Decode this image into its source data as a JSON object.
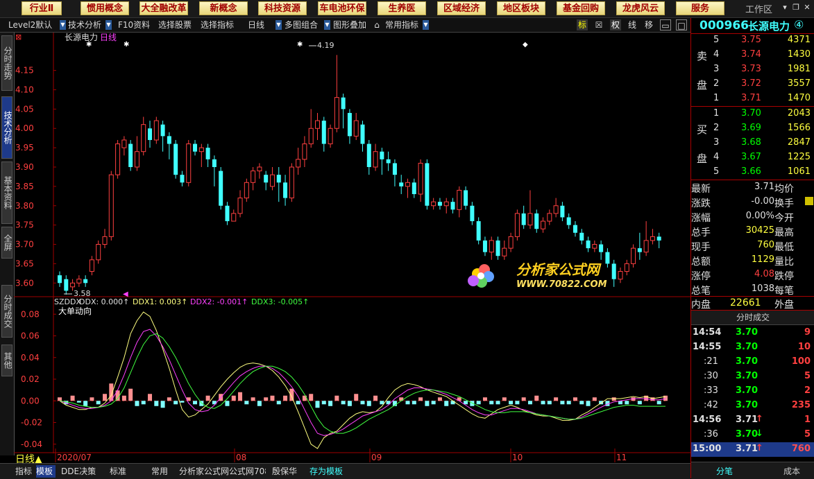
{
  "menu": {
    "items": [
      "行业Ⅱ",
      "惯用概念",
      "大全融改革",
      "新概念",
      "科技资源",
      "车电池环保",
      "生养医",
      "区域经济",
      "地区板块",
      "基金回购",
      "龙虎风云",
      "服务"
    ],
    "work_zone": "工作区"
  },
  "toolbar": {
    "items": [
      "Level2默认",
      "技术分析",
      "F10资料",
      "选择股票",
      "选择指标",
      "日线",
      "多图组合",
      "图形叠加",
      "常用指标"
    ],
    "right_items": [
      "标",
      "☒",
      "权",
      "线",
      "移"
    ]
  },
  "left_tabs": [
    "分时走势",
    "技术分析",
    "基本资料",
    "全屏",
    "分时成交",
    "其他"
  ],
  "chart": {
    "stock_title": "长源电力",
    "period_label": "日线",
    "high_label": "4.19",
    "low_label": "3.58",
    "price_ticks": [
      "4.15",
      "4.10",
      "4.05",
      "4.00",
      "3.95",
      "3.90",
      "3.85",
      "3.80",
      "3.75",
      "3.70",
      "3.65",
      "3.60"
    ],
    "indicator_header": {
      "name": "SZDDX",
      "ddx": "DDX: 0.000↑",
      "ddx1": "DDX1: 0.003↑",
      "ddx2": "DDX2: -0.001↑",
      "ddx3": "DDX3: -0.005↑"
    },
    "indicator_title": "大单动向",
    "indicator_ticks": [
      "0.08",
      "0.06",
      "0.04",
      "0.02",
      "0.00",
      "-0.02",
      "-0.04"
    ],
    "date_labels": [
      "2020/07",
      "08",
      "09",
      "10",
      "11"
    ],
    "period_bottom": "日线",
    "watermark_text": "分析家公式网",
    "watermark_url": "WWW.70822.COM"
  },
  "chart_data": {
    "type": "candlestick",
    "ylim": [
      3.57,
      4.23
    ],
    "candles": [
      [
        3.62,
        3.6,
        3.63,
        3.59
      ],
      [
        3.61,
        3.58,
        3.62,
        3.57
      ],
      [
        3.59,
        3.6,
        3.61,
        3.58
      ],
      [
        3.6,
        3.61,
        3.62,
        3.59
      ],
      [
        3.61,
        3.6,
        3.62,
        3.59
      ],
      [
        3.63,
        3.66,
        3.67,
        3.62
      ],
      [
        3.66,
        3.7,
        3.71,
        3.65
      ],
      [
        3.7,
        3.72,
        3.74,
        3.69
      ],
      [
        3.72,
        3.88,
        3.89,
        3.71
      ],
      [
        3.88,
        3.96,
        3.97,
        3.87
      ],
      [
        3.95,
        3.97,
        3.98,
        3.93
      ],
      [
        3.96,
        3.9,
        3.97,
        3.89
      ],
      [
        3.9,
        3.94,
        3.98,
        3.89
      ],
      [
        3.94,
        4.01,
        4.03,
        3.93
      ],
      [
        4.0,
        3.97,
        4.02,
        3.95
      ],
      [
        3.97,
        4.02,
        4.03,
        3.96
      ],
      [
        4.01,
        3.98,
        4.02,
        3.94
      ],
      [
        3.98,
        3.96,
        3.99,
        3.92
      ],
      [
        3.96,
        3.88,
        3.97,
        3.87
      ],
      [
        3.88,
        3.86,
        3.89,
        3.85
      ],
      [
        3.86,
        3.96,
        3.97,
        3.85
      ],
      [
        3.96,
        3.94,
        3.97,
        3.93
      ],
      [
        3.94,
        3.95,
        3.96,
        3.9
      ],
      [
        3.95,
        3.92,
        3.96,
        3.9
      ],
      [
        3.92,
        3.9,
        3.93,
        3.85
      ],
      [
        3.89,
        3.8,
        3.9,
        3.79
      ],
      [
        3.8,
        3.76,
        3.81,
        3.75
      ],
      [
        3.76,
        3.78,
        3.79,
        3.76
      ],
      [
        3.78,
        3.82,
        3.84,
        3.77
      ],
      [
        3.82,
        3.86,
        3.87,
        3.81
      ],
      [
        3.86,
        3.89,
        3.9,
        3.84
      ],
      [
        3.89,
        3.9,
        3.91,
        3.87
      ],
      [
        3.88,
        3.86,
        3.89,
        3.84
      ],
      [
        3.85,
        3.88,
        3.9,
        3.84
      ],
      [
        3.88,
        3.86,
        3.9,
        3.81
      ],
      [
        3.86,
        3.82,
        3.88,
        3.8
      ],
      [
        3.82,
        3.9,
        3.91,
        3.81
      ],
      [
        3.9,
        3.92,
        3.95,
        3.88
      ],
      [
        3.92,
        3.96,
        3.98,
        3.9
      ],
      [
        3.96,
        4.0,
        4.05,
        3.95
      ],
      [
        4.0,
        4.02,
        4.04,
        3.97
      ],
      [
        4.02,
        3.96,
        4.03,
        3.94
      ],
      [
        3.96,
        4.0,
        4.01,
        3.95
      ],
      [
        4.0,
        4.08,
        4.19,
        3.99
      ],
      [
        4.08,
        4.05,
        4.09,
        4.0
      ],
      [
        4.04,
        3.98,
        4.05,
        3.96
      ],
      [
        3.98,
        4.02,
        4.04,
        3.97
      ],
      [
        4.01,
        3.96,
        4.02,
        3.94
      ],
      [
        3.96,
        3.9,
        3.97,
        3.88
      ],
      [
        3.9,
        3.94,
        3.96,
        3.89
      ],
      [
        3.94,
        3.92,
        3.95,
        3.88
      ],
      [
        3.92,
        3.91,
        3.94,
        3.89
      ],
      [
        3.91,
        3.88,
        3.92,
        3.85
      ],
      [
        3.86,
        3.85,
        3.88,
        3.83
      ],
      [
        3.85,
        3.86,
        3.87,
        3.82
      ],
      [
        3.86,
        3.83,
        3.87,
        3.82
      ],
      [
        3.83,
        3.91,
        3.92,
        3.81
      ],
      [
        3.91,
        3.8,
        3.92,
        3.79
      ],
      [
        3.8,
        3.81,
        3.82,
        3.79
      ],
      [
        3.81,
        3.8,
        3.82,
        3.79
      ],
      [
        3.8,
        3.81,
        3.82,
        3.78
      ],
      [
        3.81,
        3.79,
        3.82,
        3.78
      ],
      [
        3.79,
        3.84,
        3.85,
        3.77
      ],
      [
        3.84,
        3.8,
        3.85,
        3.79
      ],
      [
        3.8,
        3.76,
        3.81,
        3.75
      ],
      [
        3.76,
        3.71,
        3.77,
        3.7
      ],
      [
        3.71,
        3.68,
        3.72,
        3.67
      ],
      [
        3.68,
        3.71,
        3.72,
        3.66
      ],
      [
        3.71,
        3.67,
        3.72,
        3.66
      ],
      [
        3.67,
        3.69,
        3.71,
        3.66
      ],
      [
        3.69,
        3.72,
        3.73,
        3.68
      ],
      [
        3.72,
        3.78,
        3.79,
        3.71
      ],
      [
        3.78,
        3.75,
        3.8,
        3.74
      ],
      [
        3.75,
        3.78,
        3.84,
        3.74
      ],
      [
        3.78,
        3.74,
        3.79,
        3.73
      ],
      [
        3.74,
        3.76,
        3.77,
        3.73
      ],
      [
        3.76,
        3.78,
        3.79,
        3.75
      ],
      [
        3.78,
        3.8,
        3.82,
        3.77
      ],
      [
        3.8,
        3.77,
        3.81,
        3.76
      ],
      [
        3.77,
        3.75,
        3.78,
        3.74
      ],
      [
        3.75,
        3.73,
        3.76,
        3.72
      ],
      [
        3.73,
        3.71,
        3.74,
        3.7
      ],
      [
        3.71,
        3.69,
        3.72,
        3.68
      ],
      [
        3.69,
        3.7,
        3.71,
        3.68
      ],
      [
        3.7,
        3.68,
        3.71,
        3.66
      ],
      [
        3.68,
        3.65,
        3.69,
        3.64
      ],
      [
        3.65,
        3.61,
        3.66,
        3.59
      ],
      [
        3.61,
        3.63,
        3.64,
        3.6
      ],
      [
        3.63,
        3.65,
        3.66,
        3.62
      ],
      [
        3.65,
        3.69,
        3.7,
        3.64
      ],
      [
        3.69,
        3.68,
        3.73,
        3.66
      ],
      [
        3.68,
        3.71,
        3.76,
        3.67
      ],
      [
        3.71,
        3.72,
        3.74,
        3.7
      ],
      [
        3.72,
        3.71,
        3.73,
        3.69
      ]
    ],
    "ddx_bars": [
      0.002,
      -0.002,
      0.003,
      -0.001,
      -0.003,
      0.002,
      -0.002,
      0.004,
      0.01,
      0.006,
      0.003,
      0.007,
      -0.003,
      -0.002,
      0.004,
      -0.003,
      -0.004,
      0.002,
      -0.002,
      -0.001,
      0.002,
      -0.002,
      -0.003,
      0.003,
      -0.002,
      0.004,
      -0.003,
      0.003,
      0.005,
      -0.002,
      0.002,
      -0.003,
      0.002,
      0.003,
      -0.002,
      0.003,
      0.007,
      -0.002,
      0.003,
      0.004,
      -0.004,
      -0.002,
      -0.003,
      0.003,
      -0.002,
      -0.003,
      0.004,
      -0.002,
      -0.003,
      0.003,
      -0.002,
      -0.002,
      -0.003,
      0.002,
      -0.002,
      -0.002,
      0.002,
      -0.003,
      -0.002,
      0.002,
      -0.003,
      -0.002,
      0.002,
      -0.002,
      -0.003,
      -0.002,
      0.002,
      -0.002,
      -0.002,
      0.002,
      -0.002,
      -0.002,
      0.002,
      -0.002,
      0.003,
      -0.002,
      -0.002,
      0.002,
      -0.002,
      -0.002,
      0.002,
      -0.002,
      -0.003,
      0.002,
      -0.002,
      -0.003,
      0.002,
      -0.002,
      -0.002,
      0.002,
      -0.002,
      0.003,
      0.002,
      -0.002,
      0.003
    ],
    "ddx1": [
      0.0,
      -0.004,
      -0.006,
      -0.008,
      -0.008,
      -0.006,
      -0.006,
      -0.002,
      0.005,
      0.022,
      0.04,
      0.062,
      0.074,
      0.082,
      0.078,
      0.065,
      0.048,
      0.03,
      0.01,
      -0.008,
      -0.015,
      -0.013,
      -0.008,
      -0.003,
      0.005,
      0.013,
      0.02,
      0.026,
      0.031,
      0.034,
      0.035,
      0.034,
      0.032,
      0.028,
      0.022,
      0.014,
      0.004,
      -0.01,
      -0.025,
      -0.04,
      -0.044,
      -0.034,
      -0.03,
      -0.028,
      -0.022,
      -0.016,
      -0.012,
      -0.01,
      -0.011,
      -0.01,
      -0.005,
      0.003,
      0.01,
      0.014,
      0.016,
      0.015,
      0.013,
      0.01,
      0.008,
      0.006,
      0.004,
      0.0,
      -0.004,
      -0.008,
      -0.012,
      -0.015,
      -0.016,
      -0.012,
      -0.008,
      -0.006,
      -0.004,
      -0.006,
      -0.009,
      -0.011,
      -0.013,
      -0.014,
      -0.014,
      -0.016,
      -0.018,
      -0.018,
      -0.017,
      -0.013,
      -0.01,
      -0.006,
      -0.002,
      0.002,
      0.002,
      0.002,
      0.003,
      0.004,
      0.003,
      0.004,
      0.002,
      0.003,
      0.004
    ],
    "ddx2": [
      0.0,
      -0.002,
      -0.004,
      -0.006,
      -0.007,
      -0.007,
      -0.006,
      -0.004,
      0.0,
      0.01,
      0.024,
      0.04,
      0.054,
      0.064,
      0.066,
      0.06,
      0.05,
      0.038,
      0.024,
      0.01,
      -0.002,
      -0.008,
      -0.01,
      -0.009,
      -0.004,
      0.003,
      0.01,
      0.017,
      0.023,
      0.027,
      0.03,
      0.032,
      0.032,
      0.03,
      0.026,
      0.02,
      0.013,
      0.004,
      -0.008,
      -0.02,
      -0.03,
      -0.032,
      -0.031,
      -0.029,
      -0.026,
      -0.022,
      -0.018,
      -0.014,
      -0.012,
      -0.01,
      -0.008,
      -0.004,
      0.002,
      0.006,
      0.01,
      0.012,
      0.012,
      0.011,
      0.01,
      0.008,
      0.006,
      0.003,
      0.0,
      -0.004,
      -0.008,
      -0.011,
      -0.013,
      -0.013,
      -0.011,
      -0.009,
      -0.007,
      -0.007,
      -0.008,
      -0.01,
      -0.012,
      -0.013,
      -0.014,
      -0.015,
      -0.016,
      -0.017,
      -0.017,
      -0.015,
      -0.012,
      -0.009,
      -0.006,
      -0.003,
      -0.001,
      0.0,
      0.001,
      0.002,
      0.002,
      0.002,
      0.001,
      0.001,
      0.002
    ],
    "ddx3": [
      0.0,
      -0.001,
      -0.002,
      -0.004,
      -0.005,
      -0.006,
      -0.006,
      -0.005,
      -0.003,
      0.002,
      0.012,
      0.026,
      0.04,
      0.052,
      0.06,
      0.062,
      0.058,
      0.05,
      0.04,
      0.028,
      0.016,
      0.006,
      -0.002,
      -0.006,
      -0.007,
      -0.004,
      0.002,
      0.009,
      0.016,
      0.022,
      0.027,
      0.03,
      0.032,
      0.032,
      0.03,
      0.027,
      0.022,
      0.015,
      0.006,
      -0.005,
      -0.016,
      -0.024,
      -0.028,
      -0.03,
      -0.03,
      -0.028,
      -0.025,
      -0.021,
      -0.017,
      -0.014,
      -0.011,
      -0.008,
      -0.004,
      0.0,
      0.004,
      0.007,
      0.009,
      0.01,
      0.01,
      0.009,
      0.008,
      0.006,
      0.004,
      0.001,
      -0.002,
      -0.005,
      -0.008,
      -0.01,
      -0.011,
      -0.011,
      -0.01,
      -0.01,
      -0.01,
      -0.011,
      -0.012,
      -0.013,
      -0.014,
      -0.015,
      -0.016,
      -0.017,
      -0.017,
      -0.016,
      -0.014,
      -0.012,
      -0.01,
      -0.008,
      -0.006,
      -0.005,
      -0.004,
      -0.004,
      -0.005,
      -0.005,
      -0.005,
      -0.005,
      -0.005
    ]
  },
  "quote": {
    "code": "000966",
    "name": "长源电力",
    "badge": "④",
    "sell_label_top": "卖",
    "sell_label_bottom": "盘",
    "buy_label_top": "买",
    "buy_label_bottom": "盘",
    "sells": [
      {
        "n": "5",
        "price": "3.75",
        "vol": "4371"
      },
      {
        "n": "4",
        "price": "3.74",
        "vol": "1430"
      },
      {
        "n": "3",
        "price": "3.73",
        "vol": "1981"
      },
      {
        "n": "2",
        "price": "3.72",
        "vol": "3557"
      },
      {
        "n": "1",
        "price": "3.71",
        "vol": "1470"
      }
    ],
    "buys": [
      {
        "n": "1",
        "price": "3.70",
        "vol": "2043"
      },
      {
        "n": "2",
        "price": "3.69",
        "vol": "1566"
      },
      {
        "n": "3",
        "price": "3.68",
        "vol": "2847"
      },
      {
        "n": "4",
        "price": "3.67",
        "vol": "1225"
      },
      {
        "n": "5",
        "price": "3.66",
        "vol": "1061"
      }
    ],
    "stats": [
      {
        "l": "最新",
        "v": "3.71",
        "vc": "wht",
        "r": "均价",
        "rv": ""
      },
      {
        "l": "涨跌",
        "v": "-0.00",
        "vc": "wht",
        "r": "换手",
        "rv": ""
      },
      {
        "l": "涨幅",
        "v": "0.00%",
        "vc": "wht",
        "r": "今开",
        "rv": ""
      },
      {
        "l": "总手",
        "v": "30425",
        "vc": "yel",
        "r": "最高",
        "rv": ""
      },
      {
        "l": "现手",
        "v": "760",
        "vc": "yel",
        "r": "最低",
        "rv": ""
      },
      {
        "l": "总额",
        "v": "1129",
        "vc": "yel",
        "r": "量比",
        "rv": ""
      },
      {
        "l": "涨停",
        "v": "4.08",
        "vc": "red",
        "r": "跌停",
        "rv": ""
      },
      {
        "l": "总笔",
        "v": "1038",
        "vc": "wht",
        "r": "每笔",
        "rv": ""
      }
    ],
    "inner_label": "内盘",
    "inner_value": "22661",
    "outer_label": "外盘",
    "ticks_header": "分时成交",
    "ticks": [
      {
        "t": "14:54",
        "p": "3.70",
        "pc": "grn",
        "a": "",
        "ac": "",
        "v": "9",
        "vc": "red"
      },
      {
        "t": "14:55",
        "p": "3.70",
        "pc": "grn",
        "a": "",
        "ac": "",
        "v": "10",
        "vc": "red"
      },
      {
        "t": ":21",
        "p": "3.70",
        "pc": "grn",
        "a": "",
        "ac": "",
        "v": "100",
        "vc": "red"
      },
      {
        "t": ":30",
        "p": "3.70",
        "pc": "grn",
        "a": "",
        "ac": "",
        "v": "5",
        "vc": "red"
      },
      {
        "t": ":33",
        "p": "3.70",
        "pc": "grn",
        "a": "",
        "ac": "",
        "v": "2",
        "vc": "red"
      },
      {
        "t": ":42",
        "p": "3.70",
        "pc": "grn",
        "a": "",
        "ac": "",
        "v": "235",
        "vc": "red"
      },
      {
        "t": "14:56",
        "p": "3.71",
        "pc": "wht",
        "a": "↑",
        "ac": "red",
        "v": "1",
        "vc": "red"
      },
      {
        "t": ":36",
        "p": "3.70",
        "pc": "grn",
        "a": "↓",
        "ac": "grn",
        "v": "5",
        "vc": "red"
      },
      {
        "t": "15:00",
        "p": "3.71",
        "pc": "wht",
        "a": "↑",
        "ac": "red",
        "v": "760",
        "vc": "red"
      }
    ],
    "bottom_tabs": [
      "分笔",
      "成本"
    ]
  },
  "bottom_tabs": [
    "指标",
    "模板",
    "DDE决策",
    "标准",
    "常用",
    "分析家公式网公式网7082",
    "殷保华",
    "存为模板"
  ],
  "colors": {
    "up": "#ff4040",
    "down": "#40ffff",
    "ddx1": "#ffff80",
    "ddx2": "#ff40ff",
    "ddx3": "#40ff40",
    "grid": "#800000"
  }
}
